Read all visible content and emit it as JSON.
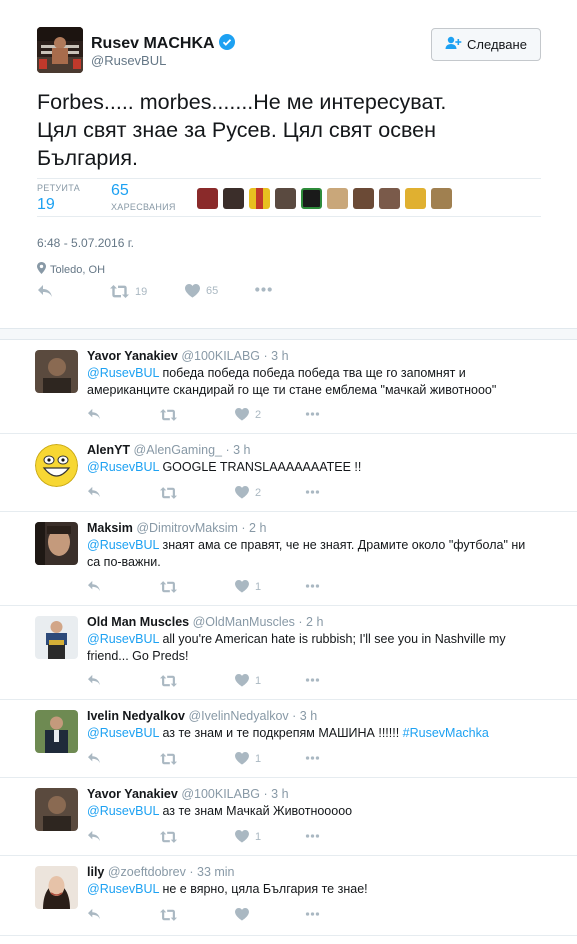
{
  "main_tweet": {
    "fullname": "Rusev MACHKA",
    "handle": "@RusevBUL",
    "follow_label": "Следване",
    "text_lines": [
      "Forbes..... morbes.......Не ме интересуват.",
      "Цял свят знае за Русев. Цял свят освен",
      "България."
    ],
    "stats": {
      "retweets_label": "РЕТУИТА",
      "retweets": "19",
      "likes_label": "ХАРЕСВАНИЯ",
      "likes": "65"
    },
    "timestamp": "6:48 - 5.07.2016 г.",
    "location": "Toledo, OH",
    "actions": {
      "retweets": "19",
      "likes": "65"
    }
  },
  "replies": [
    {
      "name": "Yavor Yanakiev",
      "handle": "@100KILABG",
      "time": "· 3 h",
      "mention": "@RusevBUL",
      "text": " победа победа победа победа тва ще го запомнят и",
      "text2": "американците скандирай го ще ти стане емблема \"мачкай животнооо\"",
      "likes": "2"
    },
    {
      "name": "AlenYT",
      "handle": "@AlenGaming_",
      "time": "· 3 h",
      "mention": "@RusevBUL",
      "text": "  GOOGLE TRANSLAAAAAAATEE !!",
      "likes": "2"
    },
    {
      "name": "Maksim",
      "handle": "@DimitrovMaksim",
      "time": "· 2 h",
      "mention": "@RusevBUL",
      "text": " знаят ама се правят, че не знаят. Драмите около \"футбола\" ни",
      "text2": "са по-важни.",
      "likes": "1"
    },
    {
      "name": "Old Man Muscles",
      "handle": "@OldManMuscles",
      "time": "· 2 h",
      "mention": "@RusevBUL",
      "text": " all you're American hate is rubbish; I'll see you in Nashville my",
      "text2": "friend... Go Preds!",
      "likes": "1"
    },
    {
      "name": "Ivelin Nedyalkov",
      "handle": "@IvelinNedyalkov",
      "time": "· 3 h",
      "mention": "@RusevBUL",
      "text": " аз те знам и те подкрепям МАШИНА !!!!!! ",
      "hashtag": "#RusevMachka",
      "likes": "1"
    },
    {
      "name": "Yavor Yanakiev",
      "handle": "@100KILABG",
      "time": "· 3 h",
      "mention": "@RusevBUL",
      "text": " аз те знам Мачкай Животнооооо",
      "likes": "1"
    },
    {
      "name": "lily",
      "handle": "@zoeftdobrev",
      "time": "· 33 min",
      "mention": "@RusevBUL",
      "text": " не е вярно, цяла България те знае!",
      "likes": ""
    }
  ],
  "colors": {
    "accent": "#1da1f2",
    "muted": "#8899a6",
    "like_active": "#aab8c2",
    "text": "#14171a"
  },
  "icons": [
    "verified-icon",
    "follow-person-icon",
    "location-pin-icon",
    "reply-icon",
    "retweet-icon",
    "like-icon",
    "more-icon"
  ]
}
